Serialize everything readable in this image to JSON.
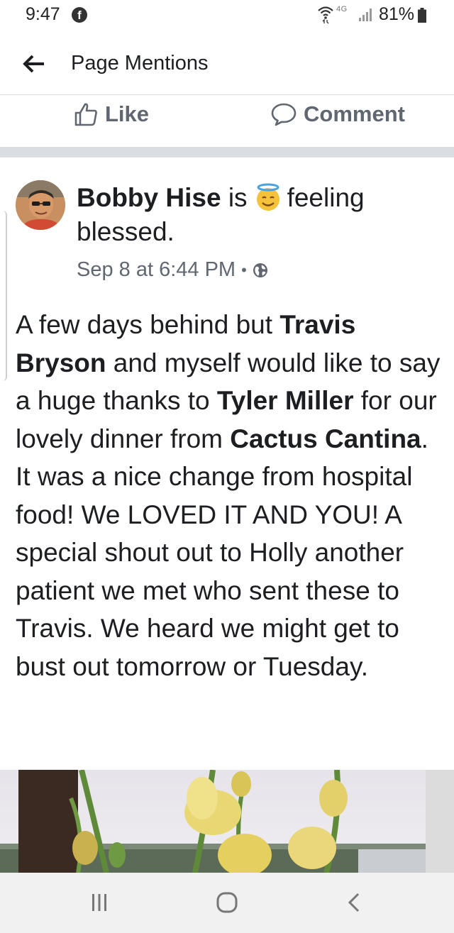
{
  "status_bar": {
    "time": "9:47",
    "network": "4G",
    "battery": "81%",
    "icons": [
      "facebook-icon",
      "wifi-icon",
      "signal-icon",
      "battery-icon"
    ]
  },
  "header": {
    "title": "Page Mentions",
    "back_icon": "back-arrow-icon"
  },
  "actions": {
    "like_label": "Like",
    "comment_label": "Comment"
  },
  "post": {
    "author": "Bobby Hise",
    "is_text": "is",
    "feeling_text": "feeling blessed.",
    "feeling_emoji": "halo-smile-icon",
    "timestamp": "Sep 8 at 6:44 PM",
    "meta_separator": "•",
    "privacy_icon": "globe-icon",
    "body": {
      "t1": "A few days behind but ",
      "m1": "Travis Bryson",
      "t2": " and myself would like to say a huge thanks to ",
      "m2": "Tyler Miller",
      "t3": " for our lovely dinner from ",
      "m3": "Cactus Cantina",
      "t4": ". It was a nice change from hospital food! We LOVED IT AND YOU! A special shout out to Holly another patient we met who sent these to Travis. We heard we might get to bust out tomorrow or Tuesday."
    }
  },
  "nav_bar": {
    "icons": [
      "recent-apps-icon",
      "home-icon",
      "nav-back-icon"
    ]
  },
  "colors": {
    "text": "#1c1e21",
    "secondary": "#606770",
    "divider": "#dadde1"
  }
}
